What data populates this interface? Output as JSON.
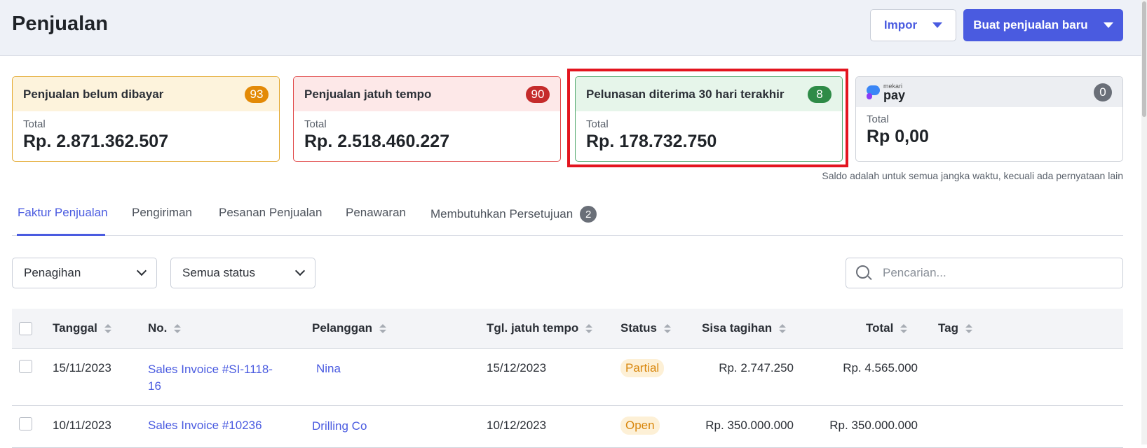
{
  "header": {
    "title": "Penjualan",
    "import_label": "Impor",
    "new_sale_label": "Buat penjualan baru"
  },
  "cards": [
    {
      "title": "Penjualan belum dibayar",
      "count": "93",
      "total_label": "Total",
      "total": "Rp. 2.871.362.507"
    },
    {
      "title": "Penjualan jatuh tempo",
      "count": "90",
      "total_label": "Total",
      "total": "Rp. 2.518.460.227"
    },
    {
      "title": "Pelunasan diterima 30 hari terakhir",
      "count": "8",
      "total_label": "Total",
      "total": "Rp. 178.732.750"
    },
    {
      "brand_small": "mekari",
      "brand_big": "pay",
      "count": "0",
      "total_label": "Total",
      "total": "Rp 0,00"
    }
  ],
  "note": "Saldo adalah untuk semua jangka waktu, kecuali ada pernyataan lain",
  "tabs": [
    {
      "label": "Faktur Penjualan",
      "active": true
    },
    {
      "label": "Pengiriman"
    },
    {
      "label": "Pesanan Penjualan"
    },
    {
      "label": "Penawaran"
    },
    {
      "label": "Membutuhkan Persetujuan",
      "count": "2"
    }
  ],
  "filters": {
    "type_value": "Penagihan",
    "status_value": "Semua status",
    "search_placeholder": "Pencarian..."
  },
  "table": {
    "columns": [
      "Tanggal",
      "No.",
      "Pelanggan",
      "Tgl. jatuh tempo",
      "Status",
      "Sisa tagihan",
      "Total",
      "Tag"
    ],
    "rows": [
      {
        "date": "15/11/2023",
        "no_line1": "Sales Invoice #SI-1118-",
        "no_line2": "16",
        "customer": "Nina",
        "due": "15/12/2023",
        "status": "Partial",
        "balance": "Rp. 2.747.250",
        "total": "Rp. 4.565.000",
        "tag": ""
      },
      {
        "date": "10/11/2023",
        "no_line1": "Sales Invoice #10236",
        "no_line2": "",
        "customer": "Drilling Co",
        "due": "10/12/2023",
        "status": "Open",
        "balance": "Rp. 350.000.000",
        "total": "Rp. 350.000.000",
        "tag": ""
      }
    ]
  },
  "colors": {
    "accent": "#4a5be0",
    "unpaid": "#e38a06",
    "overdue": "#c52b2b",
    "paid": "#2e8b47",
    "highlight": "#e3151f"
  }
}
